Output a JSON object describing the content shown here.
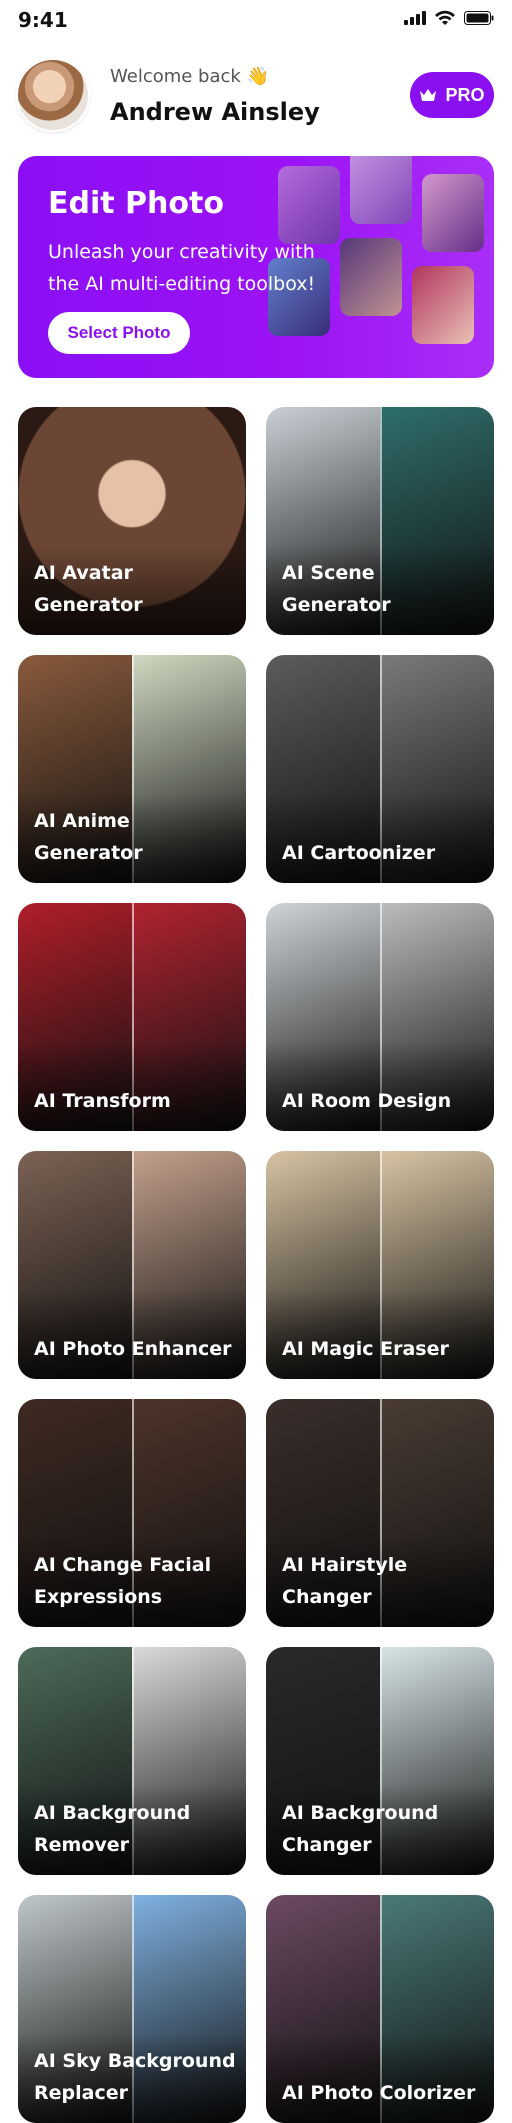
{
  "status": {
    "time": "9:41"
  },
  "header": {
    "welcome": "Welcome back 👋",
    "name": "Andrew Ainsley",
    "pro_label": "PRO"
  },
  "banner": {
    "title": "Edit Photo",
    "subtitle": "Unleash your creativity with the AI multi-editing toolbox!",
    "button": "Select Photo"
  },
  "tools": [
    {
      "label": "AI Avatar Generator",
      "colors": [
        "#6c4634",
        "#2b1a14"
      ],
      "split": false
    },
    {
      "label": "AI Scene Generator",
      "colors": [
        "#c9d0d5",
        "#2f6e6b"
      ],
      "split": true
    },
    {
      "label": "AI Anime Generator",
      "colors": [
        "#8a5a3c",
        "#cfd8c0"
      ],
      "split": true
    },
    {
      "label": "AI Cartoonizer",
      "colors": [
        "#5c5c5c",
        "#7a7a7a"
      ],
      "split": true
    },
    {
      "label": "AI Transform",
      "colors": [
        "#b01e2a",
        "#b12331"
      ],
      "split": true
    },
    {
      "label": "AI Room Design",
      "colors": [
        "#cfd3d6",
        "#bdbcbc"
      ],
      "split": true
    },
    {
      "label": "AI Photo Enhancer",
      "colors": [
        "#7c6254",
        "#c3a08c"
      ],
      "split": true
    },
    {
      "label": "AI Magic Eraser",
      "colors": [
        "#d8c4a3",
        "#d8c4a3"
      ],
      "split": true
    },
    {
      "label": "AI Change Facial Expressions",
      "colors": [
        "#3f2a22",
        "#4e342a"
      ],
      "split": true
    },
    {
      "label": "AI Hairstyle Changer",
      "colors": [
        "#3a2e2a",
        "#4a3c33"
      ],
      "split": true
    },
    {
      "label": "AI Background Remover",
      "colors": [
        "#4d6b5a",
        "#dadada"
      ],
      "split": true
    },
    {
      "label": "AI Background Changer",
      "colors": [
        "#2a2a2a",
        "#d7e4e6"
      ],
      "split": true
    },
    {
      "label": "AI Sky Background Replacer",
      "colors": [
        "#bfc7c9",
        "#7fb1e0"
      ],
      "split": true
    },
    {
      "label": "AI Photo Colorizer",
      "colors": [
        "#6c4a63",
        "#4a7a79"
      ],
      "split": true
    }
  ]
}
